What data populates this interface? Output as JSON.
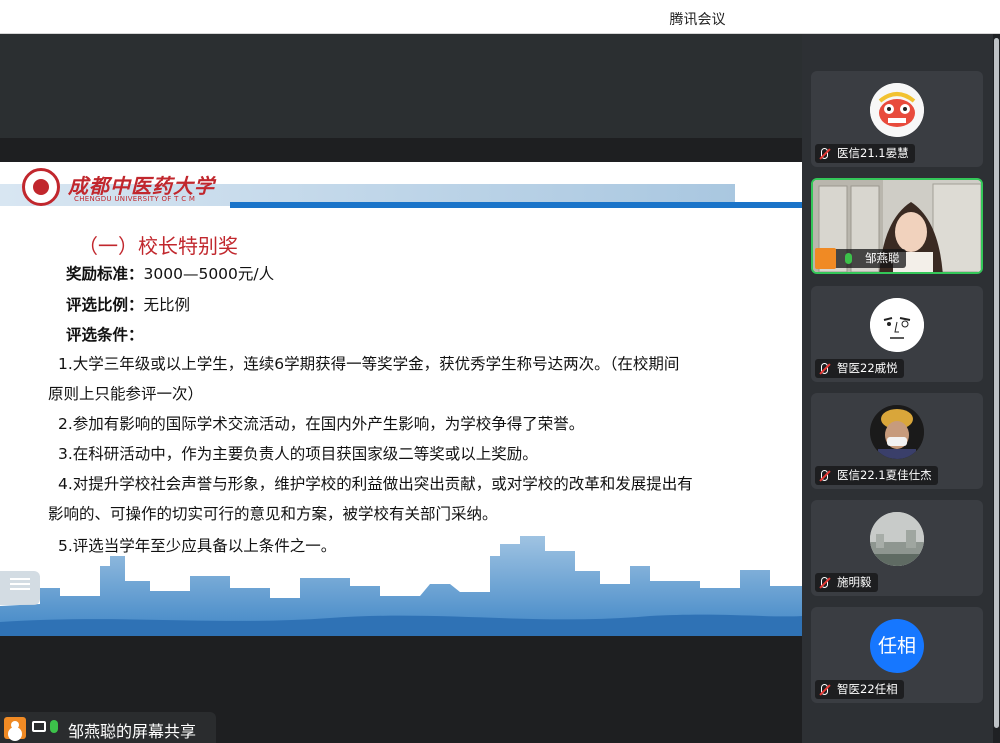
{
  "window": {
    "title": "腾讯会议"
  },
  "slide": {
    "university_cn": "成都中医药大学",
    "university_en": "CHENGDU UNIVERSITY OF T C M",
    "heading": "（一）校长特别奖",
    "award_standard_label": "奖励标准：",
    "award_standard_value": "3000—5000元/人",
    "ratio_label": "评选比例：",
    "ratio_value": "无比例",
    "conditions_label": "评选条件：",
    "conditions": [
      "1.大学三年级或以上学生，连续6学期获得一等奖学金，获优秀学生称号达两次。（在校期间",
      "原则上只能参评一次）",
      "2.参加有影响的国际学术交流活动，在国内外产生影响，为学校争得了荣誉。",
      "3.在科研活动中，作为主要负责人的项目获国家级二等奖或以上奖励。",
      "4.对提升学校社会声誉与形象，维护学校的利益做出突出贡献，或对学校的改革和发展提出有",
      "影响的、可操作的切实可行的意见和方案，被学校有关部门采纳。",
      "5.评选当学年至少应具备以上条件之一。"
    ]
  },
  "screen_share": {
    "label": "邹燕聪的屏幕共享"
  },
  "participants": [
    {
      "name": "医信21.1晏慧",
      "avatar": "lion-dance-avatar",
      "muted": true
    },
    {
      "name": "邹燕聪",
      "avatar": "camera-video",
      "muted": false,
      "speaking": true
    },
    {
      "name": "智医22戚悦",
      "avatar": "sketch-face-avatar",
      "muted": true
    },
    {
      "name": "医信22.1夏佳仕杰",
      "avatar": "masked-person-avatar",
      "muted": true
    },
    {
      "name": "施明毅",
      "avatar": "cityscape-avatar",
      "muted": true
    },
    {
      "name": "智医22任相",
      "avatar_text": "任相",
      "muted": true
    }
  ],
  "colors": {
    "brand_red": "#c1272d",
    "accent_blue": "#1a74c9",
    "avatar_blue": "#1677ff",
    "speaking_green": "#34c759"
  }
}
